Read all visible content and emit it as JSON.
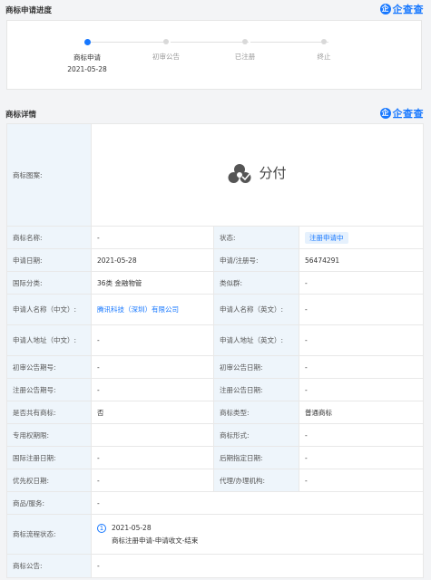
{
  "progress": {
    "title": "商标申请进度",
    "brand": "企查查",
    "steps": [
      {
        "label": "商标申请",
        "date": "2021-05-28"
      },
      {
        "label": "初审公告",
        "date": ""
      },
      {
        "label": "已注册",
        "date": ""
      },
      {
        "label": "终止",
        "date": ""
      }
    ]
  },
  "details": {
    "title": "商标详情",
    "brand": "企查查",
    "logo_label": "商标图案:",
    "logo_text": "分付",
    "rows": {
      "name_k": "商标名称:",
      "name_v": "-",
      "status_k": "状态:",
      "status_v": "注册申请中",
      "apply_date_k": "申请日期:",
      "apply_date_v": "2021-05-28",
      "reg_no_k": "申请/注册号:",
      "reg_no_v": "56474291",
      "intl_class_k": "国际分类:",
      "intl_class_v": "36类 金融物管",
      "similar_k": "类似群:",
      "similar_v": "-",
      "applicant_cn_k": "申请人名称（中文）:",
      "applicant_cn_v": "腾讯科技（深圳）有限公司",
      "applicant_en_k": "申请人名称（英文）:",
      "applicant_en_v": "-",
      "addr_cn_k": "申请人地址（中文）:",
      "addr_cn_v": "-",
      "addr_en_k": "申请人地址（英文）:",
      "addr_en_v": "-",
      "prelim_no_k": "初审公告期号:",
      "prelim_no_v": "-",
      "prelim_date_k": "初审公告日期:",
      "prelim_date_v": "-",
      "reg_ann_no_k": "注册公告期号:",
      "reg_ann_no_v": "-",
      "reg_ann_date_k": "注册公告日期:",
      "reg_ann_date_v": "-",
      "shared_k": "是否共有商标:",
      "shared_v": "否",
      "type_k": "商标类型:",
      "type_v": "普通商标",
      "exclusive_k": "专用权期限:",
      "exclusive_v": "",
      "form_k": "商标形式:",
      "form_v": "-",
      "intl_reg_k": "国际注册日期:",
      "intl_reg_v": "-",
      "later_k": "后期指定日期:",
      "later_v": "-",
      "priority_k": "优先权日期:",
      "priority_v": "-",
      "agent_k": "代理/办理机构:",
      "agent_v": "-",
      "goods_k": "商品/服务:",
      "goods_v": "-",
      "flow_k": "商标流程状态:",
      "flow_num": "1",
      "flow_date": "2021-05-28",
      "flow_desc": "商标注册申请-申请收文-结束",
      "notice_k": "商标公告:",
      "notice_v": "-"
    }
  }
}
